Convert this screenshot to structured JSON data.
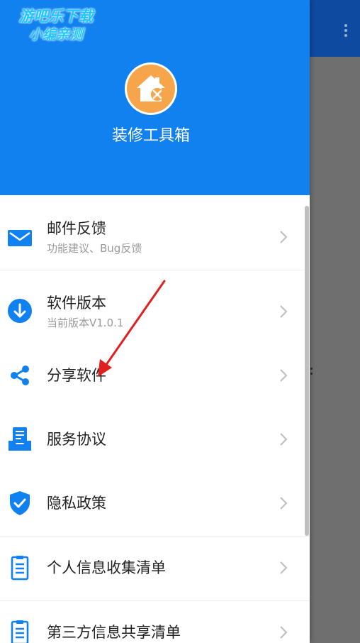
{
  "watermark": {
    "line1": "游吧乐下载",
    "line2": "小编亲测"
  },
  "header": {
    "app_name": "装修工具箱",
    "logo_icon": "house-tools-icon"
  },
  "menu": [
    {
      "title": "邮件反馈",
      "subtitle": "功能建议、Bug反馈",
      "icon": "mail-icon"
    },
    {
      "title": "软件版本",
      "subtitle": "当前版本V1.0.1",
      "icon": "download-circle-icon"
    },
    {
      "title": "分享软件",
      "subtitle": "",
      "icon": "share-icon"
    },
    {
      "title": "服务协议",
      "subtitle": "",
      "icon": "document-tray-icon"
    },
    {
      "title": "隐私政策",
      "subtitle": "",
      "icon": "shield-check-icon"
    },
    {
      "title": "个人信息收集清单",
      "subtitle": "",
      "icon": "clipboard-list-icon"
    },
    {
      "title": "第三方信息共享清单",
      "subtitle": "",
      "icon": "clipboard-list-icon"
    }
  ],
  "colors": {
    "header_blue": "#1181f0",
    "icon_blue": "#1181f0",
    "logo_orange": "#f7a54a",
    "annotation_red": "#e02020"
  }
}
